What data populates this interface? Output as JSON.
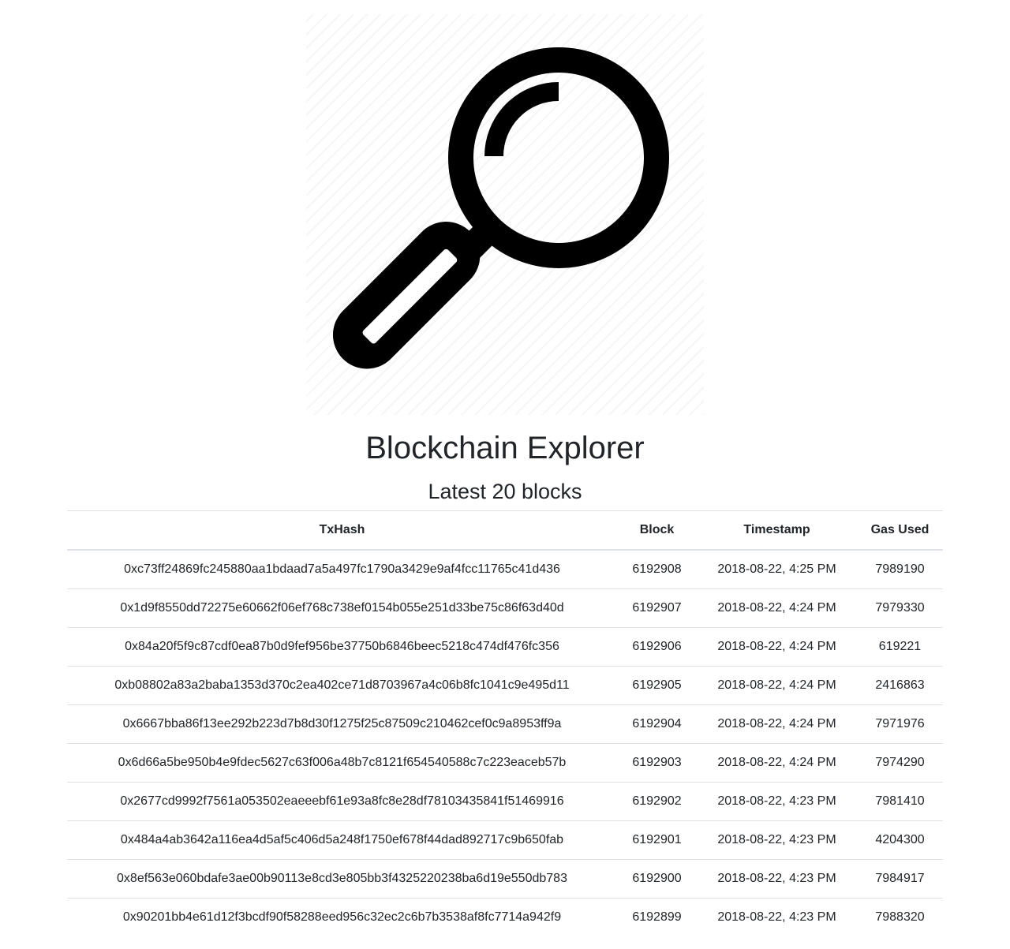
{
  "logo": {
    "icon": "magnifying-glass-icon"
  },
  "header": {
    "title": "Blockchain Explorer",
    "subtitle": "Latest 20 blocks"
  },
  "table": {
    "columns": [
      "TxHash",
      "Block",
      "Timestamp",
      "Gas Used"
    ],
    "rows": [
      [
        "0xc73ff24869fc245880aa1bdaad7a5a497fc1790a3429e9af4fcc11765c41d436",
        "6192908",
        "2018-08-22, 4:25 PM",
        "7989190"
      ],
      [
        "0x1d9f8550dd72275e60662f06ef768c738ef0154b055e251d33be75c86f63d40d",
        "6192907",
        "2018-08-22, 4:24 PM",
        "7979330"
      ],
      [
        "0x84a20f5f9c87cdf0ea87b0d9fef956be37750b6846beec5218c474df476fc356",
        "6192906",
        "2018-08-22, 4:24 PM",
        "619221"
      ],
      [
        "0xb08802a83a2baba1353d370c2ea402ce71d8703967a4c06b8fc1041c9e495d11",
        "6192905",
        "2018-08-22, 4:24 PM",
        "2416863"
      ],
      [
        "0x6667bba86f13ee292b223d7b8d30f1275f25c87509c210462cef0c9a8953ff9a",
        "6192904",
        "2018-08-22, 4:24 PM",
        "7971976"
      ],
      [
        "0x6d66a5be950b4e9fdec5627c63f006a48b7c8121f654540588c7c223eaceb57b",
        "6192903",
        "2018-08-22, 4:24 PM",
        "7974290"
      ],
      [
        "0x2677cd9992f7561a053502eaeeebf61e93a8fc8e28df78103435841f51469916",
        "6192902",
        "2018-08-22, 4:23 PM",
        "7981410"
      ],
      [
        "0x484a4ab3642a116ea4d5af5c406d5a248f1750ef678f44dad892717c9b650fab",
        "6192901",
        "2018-08-22, 4:23 PM",
        "4204300"
      ],
      [
        "0x8ef563e060bdafe3ae00b90113e8cd3e805bb3f4325220238ba6d19e550db783",
        "6192900",
        "2018-08-22, 4:23 PM",
        "7984917"
      ],
      [
        "0x90201bb4e61d12f3bcdf90f58288eed956c32ec2c6b7b3538af8fc7714a942f9",
        "6192899",
        "2018-08-22, 4:23 PM",
        "7988320"
      ]
    ]
  }
}
